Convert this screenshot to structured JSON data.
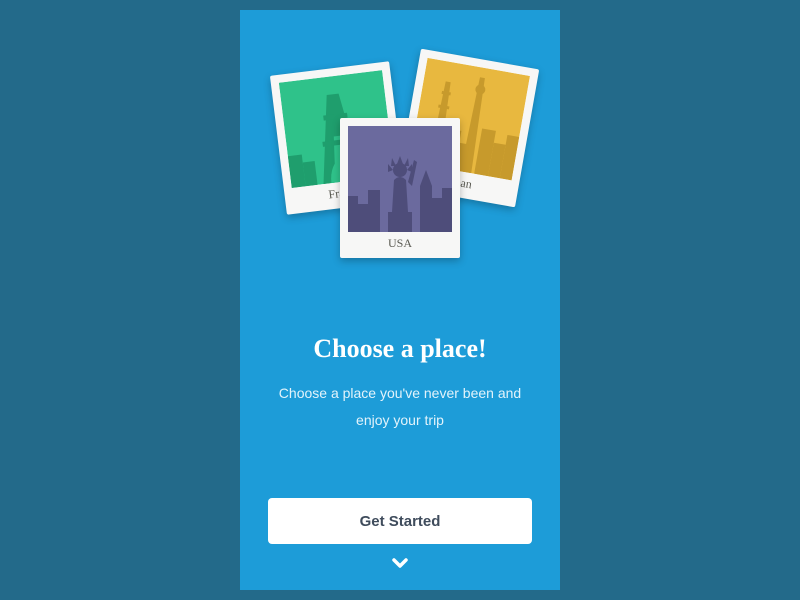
{
  "cards": {
    "france": {
      "label": "France",
      "color": "#2fc28a",
      "darkcolor": "#1f9e6d"
    },
    "usa": {
      "label": "USA",
      "color": "#6b6a9e",
      "darkcolor": "#53527f"
    },
    "japan": {
      "label": "Japan",
      "color": "#e8b83f",
      "darkcolor": "#c79a2c"
    }
  },
  "heading": "Choose a place!",
  "subheading": "Choose a place you've never been and enjoy your trip",
  "cta_label": "Get Started"
}
